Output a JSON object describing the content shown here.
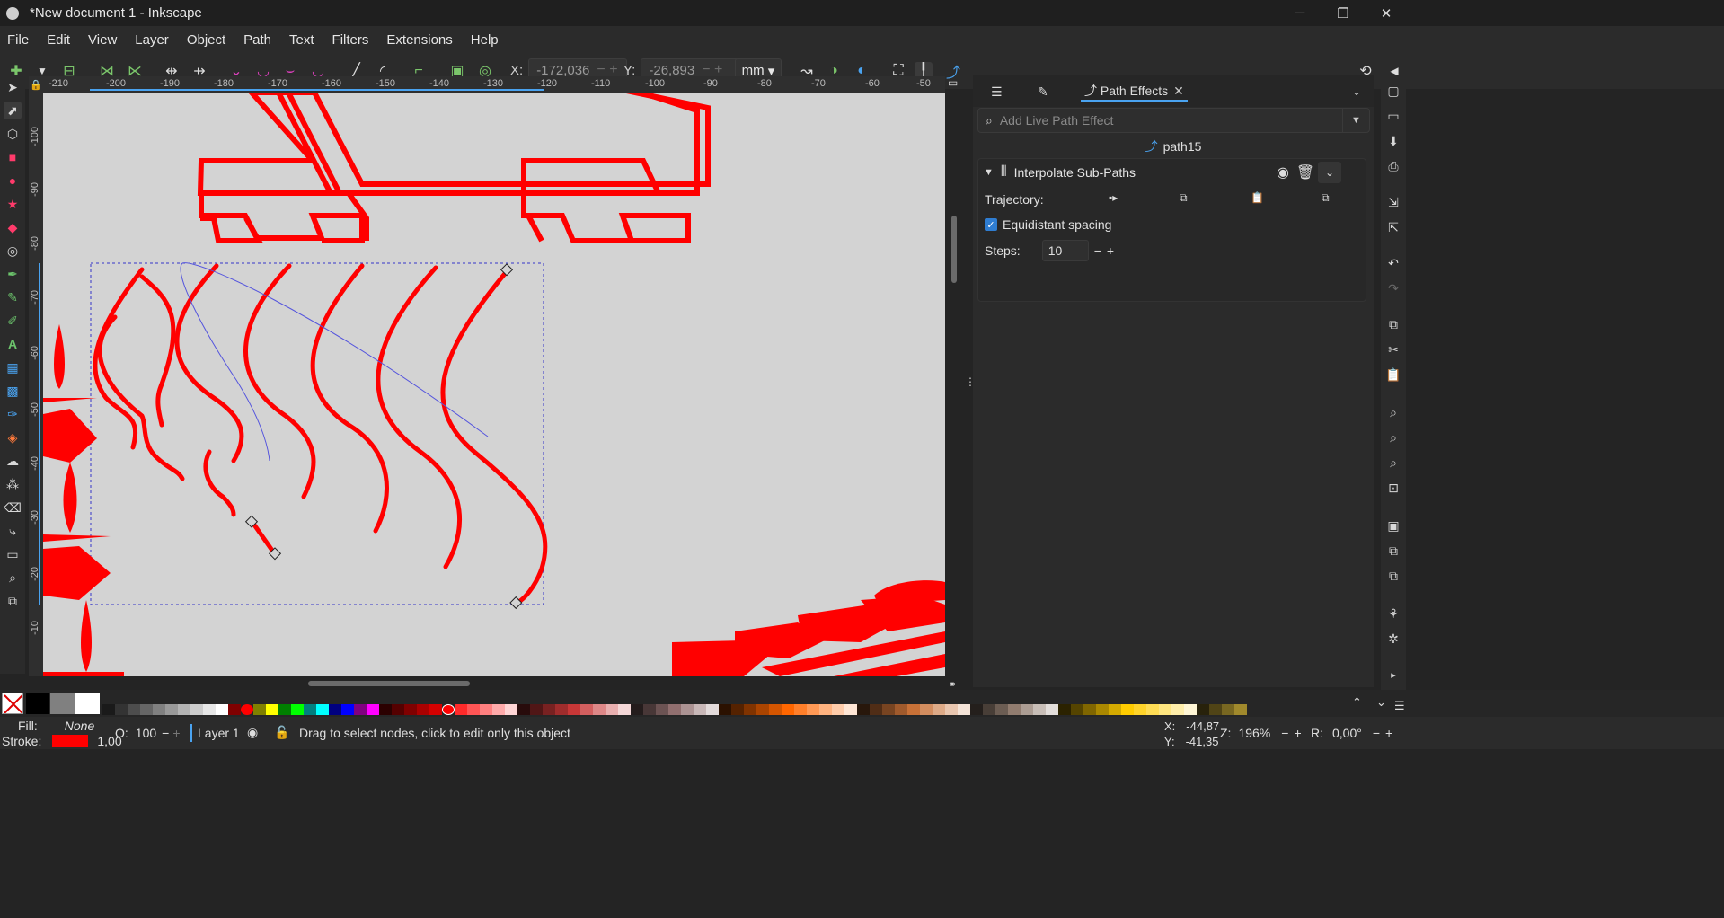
{
  "window": {
    "title": "*New document 1 - Inkscape",
    "buttons": [
      "─",
      "❐",
      "✕"
    ]
  },
  "menu": [
    "File",
    "Edit",
    "View",
    "Layer",
    "Object",
    "Path",
    "Text",
    "Filters",
    "Extensions",
    "Help"
  ],
  "toolbar": {
    "x_label": "X:",
    "x_value": "-172,036",
    "y_label": "Y:",
    "y_value": "-26,893",
    "unit": "mm"
  },
  "ruler": {
    "top_ticks": [
      "-210",
      "-200",
      "-190",
      "-180",
      "-170",
      "-160",
      "-150",
      "-140",
      "-130",
      "-120",
      "-110",
      "-100",
      "-90",
      "-80",
      "-70",
      "-60",
      "-50"
    ],
    "left_ticks": [
      "-100",
      "-90",
      "-80",
      "-70",
      "-60",
      "-50",
      "-40",
      "-30",
      "-20",
      "-10"
    ]
  },
  "dock": {
    "tab_active": "Path Effects",
    "search_placeholder": "Add Live Path Effect",
    "path_name": "path15",
    "effect": {
      "name": "Interpolate Sub-Paths",
      "trajectory_label": "Trajectory:",
      "equidistant_label": "Equidistant spacing",
      "equidistant_checked": true,
      "steps_label": "Steps:",
      "steps_value": "10"
    }
  },
  "palette": {
    "colors": [
      "#000000",
      "#808080",
      "#ffffff"
    ],
    "accent_red": "#ff0000"
  },
  "status": {
    "fill_label": "Fill:",
    "fill_value": "None",
    "stroke_label": "Stroke:",
    "stroke_width": "1,00",
    "opacity_label": "O:",
    "opacity_value": "100",
    "layer": "Layer 1",
    "message": "Drag to select nodes, click to edit only this object",
    "cursor_x_label": "X:",
    "cursor_x": "-44,87",
    "cursor_y_label": "Y:",
    "cursor_y": "-41,35",
    "zoom_label": "Z:",
    "zoom": "196%",
    "rotation_label": "R:",
    "rotation": "0,00°"
  }
}
